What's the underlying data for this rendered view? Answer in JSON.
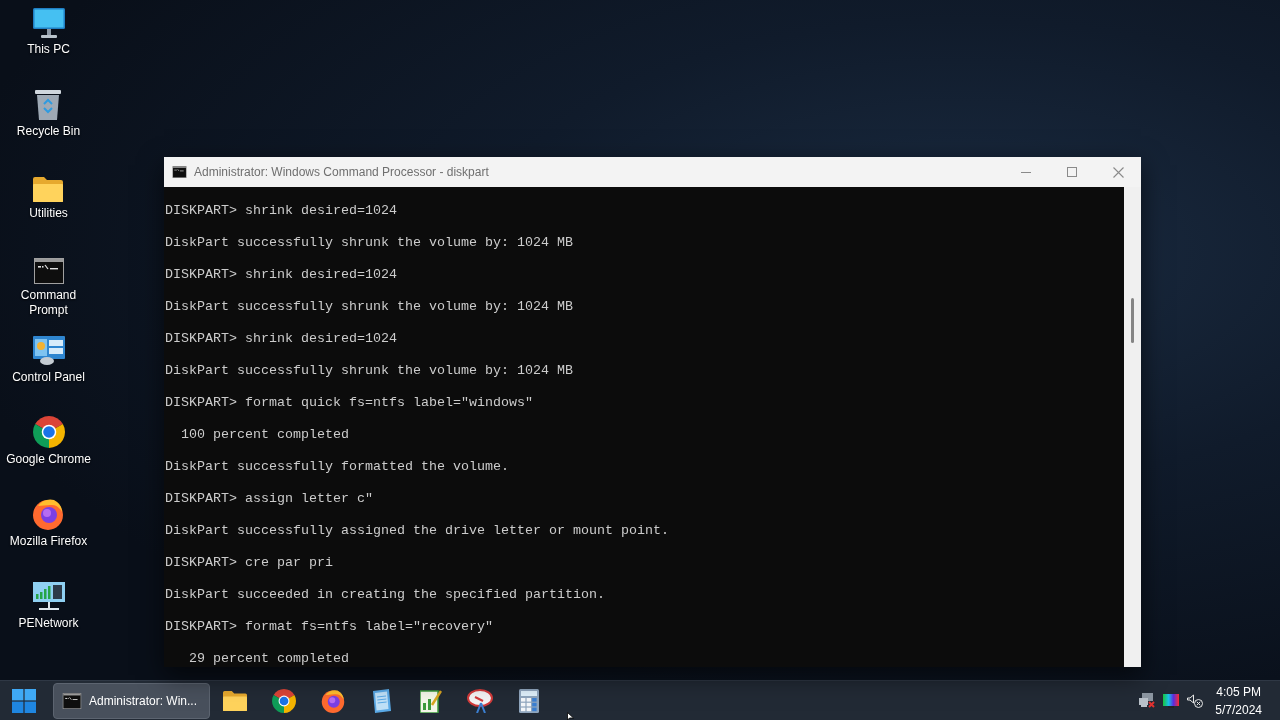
{
  "desktop": {
    "icons": [
      {
        "label": "This PC"
      },
      {
        "label": "Recycle Bin"
      },
      {
        "label": "Utilities"
      },
      {
        "label": "Command Prompt"
      },
      {
        "label": "Control Panel"
      },
      {
        "label": "Google Chrome"
      },
      {
        "label": "Mozilla Firefox"
      },
      {
        "label": "PENetwork"
      }
    ]
  },
  "window": {
    "title": "Administrator: Windows Command Processor - diskpart",
    "console_lines": [
      "DISKPART> shrink desired=1024",
      "DiskPart successfully shrunk the volume by: 1024 MB",
      "DISKPART> shrink desired=1024",
      "DiskPart successfully shrunk the volume by: 1024 MB",
      "DISKPART> shrink desired=1024",
      "DiskPart successfully shrunk the volume by: 1024 MB",
      "DISKPART> format quick fs=ntfs label=\"windows\"",
      "  100 percent completed",
      "DiskPart successfully formatted the volume.",
      "DISKPART> assign letter c\"",
      "DiskPart successfully assigned the drive letter or mount point.",
      "DISKPART> cre par pri",
      "DiskPart succeeded in creating the specified partition.",
      "DISKPART> format fs=ntfs label=\"recovery\"",
      "   29 percent completed"
    ]
  },
  "taskbar": {
    "task_buttons": [
      {
        "label": "Administrator: Win...",
        "selected": true
      }
    ],
    "clock": {
      "time": "4:05 PM",
      "date": "5/7/2024"
    }
  }
}
